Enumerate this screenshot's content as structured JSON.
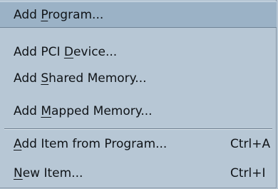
{
  "menu": {
    "items": [
      {
        "pre": "Add ",
        "mn": "P",
        "post": "rogram...",
        "shortcut": ""
      },
      {
        "pre": "Add PCI ",
        "mn": "D",
        "post": "evice...",
        "shortcut": ""
      },
      {
        "pre": "Add ",
        "mn": "S",
        "post": "hared Memory...",
        "shortcut": ""
      },
      {
        "pre": "Add ",
        "mn": "M",
        "post": "apped Memory...",
        "shortcut": ""
      },
      {
        "pre": "",
        "mn": "A",
        "post": "dd Item from Program...",
        "shortcut": "Ctrl+A"
      },
      {
        "pre": "",
        "mn": "N",
        "post": "ew Item...",
        "shortcut": "Ctrl+I"
      }
    ]
  },
  "colors": {
    "menu_bg": "#b7c7d5",
    "highlight_bg": "#9bb2c6",
    "text": "#101418"
  }
}
